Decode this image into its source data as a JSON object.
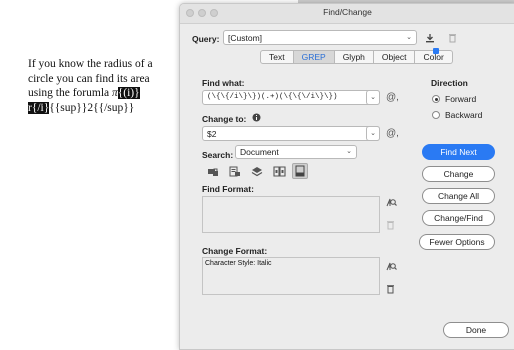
{
  "document": {
    "line1": "If you know the radius of a",
    "line2": "circle you can find its area",
    "line3_pre": "using the forumla ",
    "line3_pi": "π",
    "line3_hl": "{(i)}",
    "line4_hl": "r{/i}",
    "line4_post": "{{sup}}2{{/sup}}"
  },
  "dialog": {
    "title": "Find/Change",
    "query_label": "Query:",
    "query_value": "[Custom]",
    "tabs": [
      "Text",
      "GREP",
      "Glyph",
      "Object",
      "Color"
    ],
    "active_tab": "GREP",
    "find_what_label": "Find what:",
    "find_what_value": "(\\{\\{/i\\}\\})(.+)(\\{\\{\\/i\\}\\})",
    "change_to_label": "Change to:",
    "change_to_value": "$2",
    "search_label": "Search:",
    "search_value": "Document",
    "find_format_label": "Find Format:",
    "change_format_label": "Change Format:",
    "change_format_value": "Character Style: Italic",
    "direction_label": "Direction",
    "direction_options": [
      "Forward",
      "Backward"
    ],
    "direction_selected": "Forward",
    "buttons": {
      "find_next": "Find Next",
      "change": "Change",
      "change_all": "Change All",
      "change_find": "Change/Find",
      "fewer_options": "Fewer Options",
      "done": "Done"
    },
    "colors": {
      "primary": "#2a7af3",
      "active_tab_text": "#2a6fd6"
    }
  }
}
